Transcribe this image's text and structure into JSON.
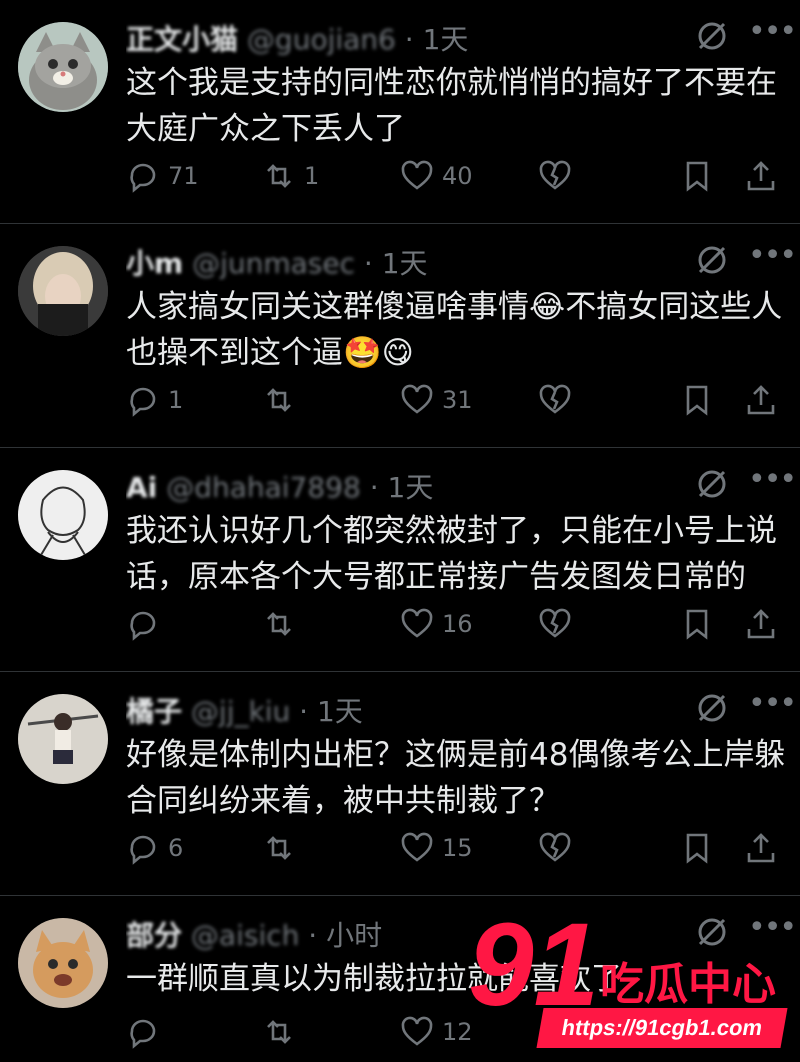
{
  "posts": [
    {
      "name": "正文小猫",
      "handle": "@guojian6",
      "time": "1天",
      "text": "这个我是支持的同性恋你就悄悄的搞好了不要在大庭广众之下丢人了",
      "text_emoji": "",
      "replies": "71",
      "retweets": "1",
      "likes": "40",
      "avatar": "cat-avatar"
    },
    {
      "name": "小m",
      "handle": "@junmasec",
      "time": "1天",
      "text": "人家搞女同关这群傻逼啥事情",
      "text_mid_emoji": "😂",
      "text_after": "不搞女同这些人也操不到这个逼",
      "text_end_emojis": "🤩😋",
      "replies": "1",
      "retweets": "",
      "likes": "31",
      "avatar": "blonde-avatar"
    },
    {
      "name": "Ai",
      "handle": "@dhahai7898",
      "time": "1天",
      "text": "我还认识好几个都突然被封了，只能在小号上说话，原本各个大号都正常接广告发图发日常的",
      "replies": "",
      "retweets": "",
      "likes": "16",
      "avatar": "sketch-avatar"
    },
    {
      "name": "橘子",
      "handle": "@jj_kiu",
      "time": "1天",
      "text": "好像是体制内出柜？这俩是前48偶像考公上岸躲合同纠纷来着，被中共制裁了？",
      "replies": "6",
      "retweets": "",
      "likes": "15",
      "avatar": "girl-avatar"
    },
    {
      "name": "部分",
      "handle": "@aisich",
      "time": "小时",
      "text": "一群顺直真以为制裁拉拉就能喜欢了",
      "replies": "",
      "retweets": "",
      "likes": "12",
      "avatar": "kitten-avatar"
    }
  ],
  "watermark": {
    "big": "91",
    "cn": "吃瓜中心",
    "url": "https://91cgb1.com"
  },
  "colors": {
    "background": "#000000",
    "text": "#e7e9ea",
    "muted": "#71767b",
    "brand": "#ff1744"
  }
}
